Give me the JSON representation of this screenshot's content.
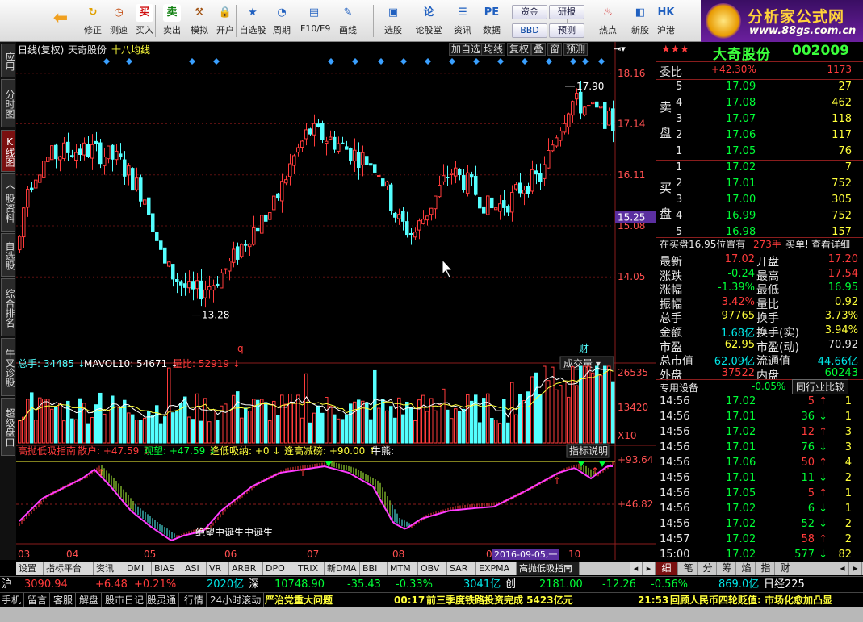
{
  "toolbar": {
    "items": [
      {
        "label": "",
        "icon": "back-arrow-icon"
      },
      {
        "label": "修正",
        "icon": "refresh-icon"
      },
      {
        "label": "测速",
        "icon": "clock-icon"
      },
      {
        "label": "买入",
        "icon": "buy-icon",
        "glyph": "买"
      },
      {
        "label": "卖出",
        "icon": "sell-icon",
        "glyph": "卖"
      },
      {
        "label": "模拟",
        "icon": "hammer-icon"
      },
      {
        "label": "开户",
        "icon": "lock-icon"
      },
      {
        "label": "自选股",
        "icon": "star-icon"
      },
      {
        "label": "周期",
        "icon": "clock-cycle-icon"
      },
      {
        "label": "F10/F9",
        "icon": "f10-icon"
      },
      {
        "label": "画线",
        "icon": "pen-icon"
      },
      {
        "label": "选股",
        "icon": "screen-icon"
      },
      {
        "label": "论股堂",
        "icon": "forum-icon"
      },
      {
        "label": "资讯",
        "icon": "news-icon"
      },
      {
        "label": "数据",
        "icon": "pe-icon"
      },
      {
        "label": "热点",
        "icon": "hot-icon"
      },
      {
        "label": "新股",
        "icon": "ipo-icon"
      },
      {
        "label": "沪港",
        "icon": "hk-icon"
      }
    ],
    "small": {
      "zijin": "资金",
      "yanbao": "研报",
      "bbd": "BBD",
      "yuce": "预测"
    },
    "logo": {
      "title": "分析家公式网",
      "url": "www.88gs.com.cn"
    }
  },
  "vtabs": [
    "应用",
    "分时图",
    "K线图",
    "个股资料",
    "自选股",
    "综合排名",
    "牛叉诊股",
    "超级盘口"
  ],
  "chart": {
    "header": {
      "period": "日线(复权)",
      "name": "天奇股份",
      "ma": "十八均线"
    },
    "tabs": [
      "加自选",
      "均线",
      "复权",
      "叠",
      "窗",
      "预测"
    ],
    "price_axis": [
      "18.16",
      "17.14",
      "16.11",
      "15.08",
      "14.05"
    ],
    "current_price_tag": "15.25",
    "high_label": "17.90",
    "low_label": "13.28",
    "event_q": "q",
    "event_cai": "财",
    "vol_header": {
      "label": "总手: 34485",
      "mavol": "MAVOL10: 54671",
      "ratio": "量比: 52919",
      "dropdown": "成交量"
    },
    "vol_axis": [
      "26535",
      "13420",
      "X10"
    ],
    "ind_header": {
      "name": "高抛低吸指南",
      "a": "散户: +47.59",
      "b": "观望: +47.59",
      "c": "逢低吸纳: +0",
      "d": "逢高减磅: +90.00",
      "e": "牛熊:"
    },
    "ind_btn": "指标说明",
    "ind_axis": [
      "+93.64",
      "+46.82"
    ],
    "ind_annotation": "绝望中诞生中诞生",
    "months": [
      "03",
      "04",
      "05",
      "06",
      "07",
      "08",
      "09",
      "10"
    ],
    "date_tag": "2016-09-05,一"
  },
  "chart_data": {
    "type": "candlestick",
    "title": "天奇股份",
    "ylim": [
      12.8,
      18.5
    ],
    "x_months": [
      "03",
      "04",
      "05",
      "06",
      "07",
      "08",
      "09",
      "10"
    ],
    "high": 17.9,
    "low": 13.28,
    "last": 17.02,
    "series": [
      {
        "name": "高抛低吸指南"
      }
    ]
  },
  "rp": {
    "stars": "★★★",
    "name": "大奇股份",
    "code": "002009",
    "weibi": {
      "label": "委比",
      "value": "+42.30%",
      "diff": "1173"
    },
    "sell_label": [
      "卖",
      "盘"
    ],
    "buy_label": [
      "买",
      "盘"
    ],
    "sell": [
      [
        "5",
        "17.09",
        "27"
      ],
      [
        "4",
        "17.08",
        "462"
      ],
      [
        "3",
        "17.07",
        "118"
      ],
      [
        "2",
        "17.06",
        "117"
      ],
      [
        "1",
        "17.05",
        "76"
      ]
    ],
    "buy": [
      [
        "1",
        "17.02",
        "7"
      ],
      [
        "2",
        "17.01",
        "752"
      ],
      [
        "3",
        "17.00",
        "305"
      ],
      [
        "4",
        "16.99",
        "752"
      ],
      [
        "5",
        "16.98",
        "157"
      ]
    ],
    "notice": {
      "pre": "在买盘16.95位置有",
      "qty": "273手",
      "post": "买单!",
      "link": "查看详细"
    },
    "quotes": [
      [
        "最新",
        "17.02",
        "开盘",
        "17.20"
      ],
      [
        "涨跌",
        "-0.24",
        "最高",
        "17.54"
      ],
      [
        "涨幅",
        "-1.39%",
        "最低",
        "16.95"
      ],
      [
        "振幅",
        "3.42%",
        "量比",
        "0.92"
      ],
      [
        "总手",
        "97765",
        "换手",
        "3.73%"
      ],
      [
        "金额",
        "1.68亿",
        "换手(实)",
        "3.94%"
      ],
      [
        "市盈",
        "62.95",
        "市盈(动)",
        "70.92"
      ],
      [
        "总市值",
        "62.09亿",
        "流通值",
        "44.66亿"
      ],
      [
        "外盘",
        "37522",
        "内盘",
        "60243"
      ]
    ],
    "device": {
      "label": "专用设备",
      "pct": "-0.05%",
      "btn": "同行业比较"
    },
    "ticks": [
      [
        "14:56",
        "17.02",
        "5",
        "up",
        "1"
      ],
      [
        "14:56",
        "17.01",
        "36",
        "dn",
        "1"
      ],
      [
        "14:56",
        "17.02",
        "12",
        "up",
        "3"
      ],
      [
        "14:56",
        "17.01",
        "76",
        "dn",
        "3"
      ],
      [
        "14:56",
        "17.06",
        "50",
        "up",
        "4"
      ],
      [
        "14:56",
        "17.01",
        "11",
        "dn",
        "2"
      ],
      [
        "14:56",
        "17.05",
        "5",
        "up",
        "1"
      ],
      [
        "14:56",
        "17.02",
        "6",
        "dn",
        "1"
      ],
      [
        "14:56",
        "17.02",
        "52",
        "dn",
        "2"
      ],
      [
        "14:57",
        "17.02",
        "58",
        "up",
        "2"
      ],
      [
        "15:00",
        "17.02",
        "577",
        "dn",
        "82"
      ]
    ]
  },
  "itabs": [
    "设置",
    "指标平台",
    "资讯",
    "DMI",
    "BIAS",
    "ASI",
    "VR",
    "ARBR",
    "DPO",
    "TRIX",
    "新DMA",
    "BBI",
    "MTM",
    "OBV",
    "SAR",
    "EXPMA",
    "高抛低吸指南"
  ],
  "rtabs": [
    "细",
    "笔",
    "分",
    "筹",
    "焰",
    "指",
    "财"
  ],
  "status1": {
    "sh": "沪",
    "sh_v": "3090.94",
    "sh_c": "+6.48",
    "sh_p": "+0.21%",
    "sh_a": "2020亿",
    "sz": "深",
    "sz_v": "10748.90",
    "sz_c": "-35.43",
    "sz_p": "-0.33%",
    "sz_a": "3041亿",
    "cy": "创",
    "cy_v": "2181.00",
    "cy_c": "-12.26",
    "cy_p": "-0.56%",
    "cy_a": "869.0亿",
    "rj": "日经225"
  },
  "status2": {
    "items": [
      "手机",
      "留言",
      "客服",
      "解盘",
      "股市日记",
      "股灵通",
      "行情",
      "24小时滚动"
    ],
    "news1": "严治党重大问题",
    "time1": "00:17",
    "news2": "前三季度铁路投资完成 5423亿元",
    "time2": "21:53",
    "news3": "回顾人民币四轮贬值: 市场化愈加凸显"
  }
}
